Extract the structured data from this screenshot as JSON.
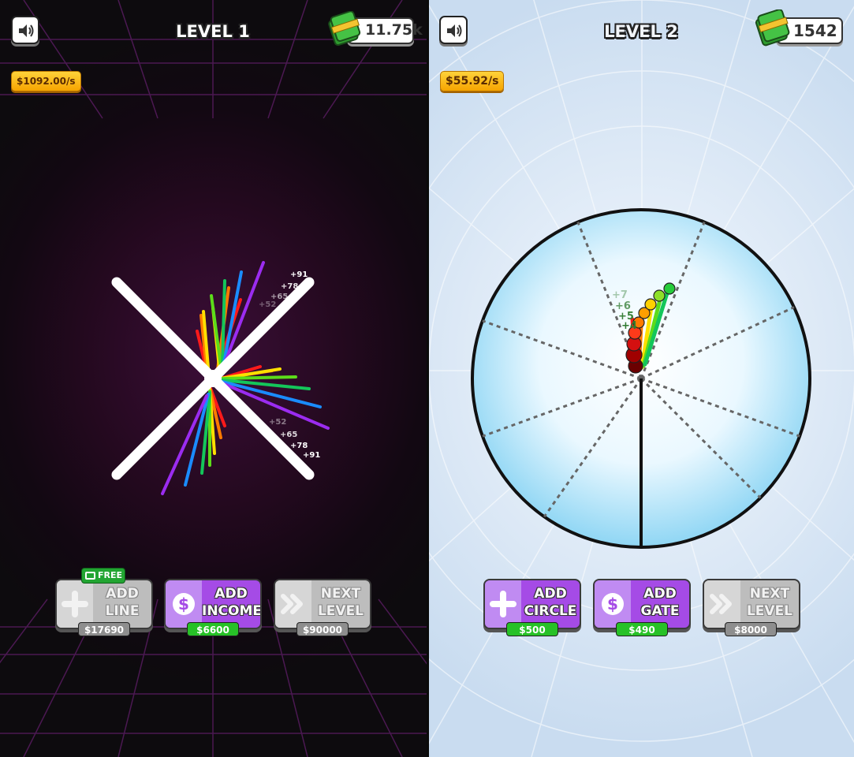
{
  "screens": [
    {
      "sound_icon": "speaker-icon",
      "level_title": "LEVEL 1",
      "money": "11.75k",
      "money_icon": "cash-stack-icon",
      "rate": "$1092.00/s",
      "gains": [
        "+91",
        "+78",
        "+65",
        "+52",
        "+52",
        "+65",
        "+78",
        "+91"
      ],
      "buttons": [
        {
          "label": "ADD\nLINE",
          "icon": "plus-icon",
          "price": "$17690",
          "state": "disabled",
          "badge": "FREE"
        },
        {
          "label": "ADD\nINCOME",
          "icon": "dollar-coin-icon",
          "price": "$6600",
          "state": "enabled"
        },
        {
          "label": "NEXT\nLEVEL",
          "icon": "double-chevron-right-icon",
          "price": "$90000",
          "state": "disabled"
        }
      ]
    },
    {
      "sound_icon": "speaker-icon",
      "level_title": "LEVEL 2",
      "money": "1542",
      "money_icon": "cash-stack-icon",
      "rate": "$55.92/s",
      "gains": [
        "+7",
        "+6",
        "+5",
        "+4"
      ],
      "buttons": [
        {
          "label": "ADD\nCIRCLE",
          "icon": "plus-icon",
          "price": "$500",
          "state": "enabled"
        },
        {
          "label": "ADD\nGATE",
          "icon": "dollar-coin-icon",
          "price": "$490",
          "state": "enabled"
        },
        {
          "label": "NEXT\nLEVEL",
          "icon": "double-chevron-right-icon",
          "price": "$8000",
          "state": "disabled"
        }
      ]
    }
  ],
  "colors": {
    "rate_badge": "#f6a400",
    "price_green": "#27c127",
    "button_purple": "#a54be6",
    "button_gray": "#bdbdbd",
    "free_badge": "#22a532",
    "rainbow": [
      "#ff1a1a",
      "#ff7a00",
      "#ffe000",
      "#5cdc1a",
      "#14c65a",
      "#1a8cff",
      "#9b2cf0"
    ]
  }
}
